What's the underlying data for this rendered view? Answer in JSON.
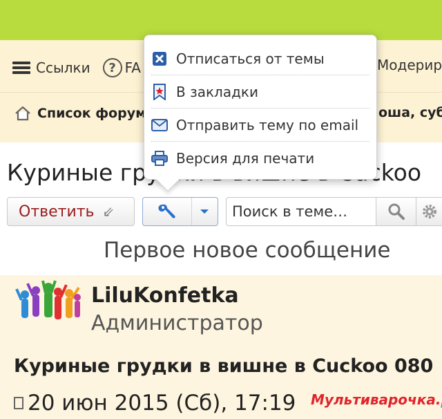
{
  "nav": {
    "links_label": "Ссылки",
    "faq_label": "FA",
    "moderators_label": "Модерир"
  },
  "breadcrumb": {
    "forum_list": "Список форумов",
    "welcome": "оша, суб"
  },
  "topic": {
    "title": "Куриные грудки в вишне в Cuckoo"
  },
  "toolbar": {
    "reply_label": "Ответить",
    "search_placeholder": "Поиск в теме…"
  },
  "first_new_post": "Первое новое сообщение",
  "post": {
    "author": "LiluKonfetka",
    "role": "Администратор",
    "title": "Куриные грудки в вишне в Cuckoo 080",
    "date": "20 июн 2015 (Сб), 17:19"
  },
  "dropdown": {
    "items": [
      {
        "label": "Отписаться от темы",
        "icon": "unsubscribe-icon"
      },
      {
        "label": "В закладки",
        "icon": "bookmark-icon"
      },
      {
        "label": "Отправить тему по email",
        "icon": "email-icon"
      },
      {
        "label": "Версия для печати",
        "icon": "print-icon"
      }
    ]
  },
  "watermark": {
    "main": "Мультиварочка.",
    "tld": "ру"
  },
  "colors": {
    "top_band": "#b8dc3e",
    "nav_bg": "#fdf2d3",
    "post_bg": "#fdf5df",
    "reply_text": "#9b1b1b",
    "accent_blue": "#2a6fc9"
  }
}
